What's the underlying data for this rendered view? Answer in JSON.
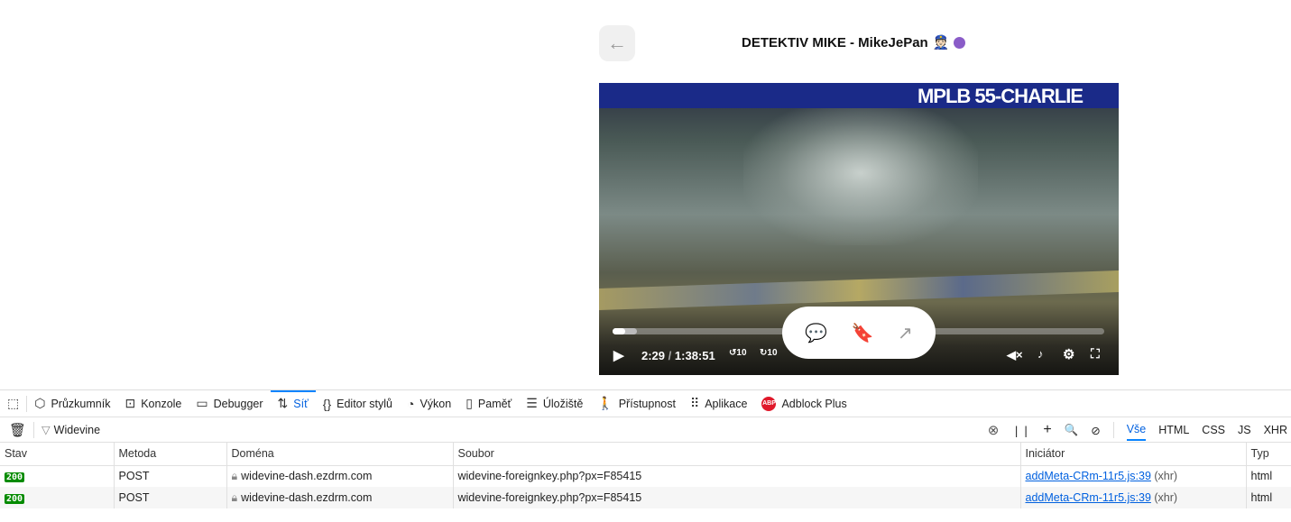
{
  "page": {
    "back_icon": "arrow-left-icon",
    "title": "DETEKTIV MIKE - MikeJePan",
    "title_emoji": "👮🏻",
    "verified_color": "#8a5cc8"
  },
  "video": {
    "overlay_label": "MPLB 55-CHARLIE",
    "current_time": "2:29",
    "time_sep": "/",
    "duration": "1:38:51",
    "progress_fraction": 0.025,
    "buffered_fraction": 0.05,
    "rewind_label": "10",
    "forward_label": "10",
    "actions": [
      "comment-add-icon",
      "bookmark-icon",
      "share-arrow-icon"
    ]
  },
  "devtools": {
    "tabs": [
      {
        "label": "Průzkumník",
        "icon": "⬡"
      },
      {
        "label": "Konzole",
        "icon": "⊡"
      },
      {
        "label": "Debugger",
        "icon": "▭"
      },
      {
        "label": "Síť",
        "icon": "⇅",
        "active": true
      },
      {
        "label": "Editor stylů",
        "icon": "{}"
      },
      {
        "label": "Výkon",
        "icon": "◔"
      },
      {
        "label": "Paměť",
        "icon": "▯"
      },
      {
        "label": "Úložiště",
        "icon": "☰"
      },
      {
        "label": "Přístupnost",
        "icon": "🚶"
      },
      {
        "label": "Aplikace",
        "icon": "⠿"
      },
      {
        "label": "Adblock Plus",
        "icon": "ABP"
      }
    ],
    "filter_value": "Widevine",
    "type_filters": [
      "Vše",
      "HTML",
      "CSS",
      "JS",
      "XHR"
    ],
    "columns": [
      "Stav",
      "Metoda",
      "Doména",
      "Soubor",
      "Iniciátor",
      "Typ"
    ],
    "rows": [
      {
        "status": "200",
        "method": "POST",
        "domain": "widevine-dash.ezdrm.com",
        "file": "widevine-foreignkey.php?px=F85415",
        "initiator": "addMeta-CRm-11r5.js:39",
        "initiator_suffix": "(xhr)",
        "type": "html"
      },
      {
        "status": "200",
        "method": "POST",
        "domain": "widevine-dash.ezdrm.com",
        "file": "widevine-foreignkey.php?px=F85415",
        "initiator": "addMeta-CRm-11r5.js:39",
        "initiator_suffix": "(xhr)",
        "type": "html"
      }
    ]
  }
}
